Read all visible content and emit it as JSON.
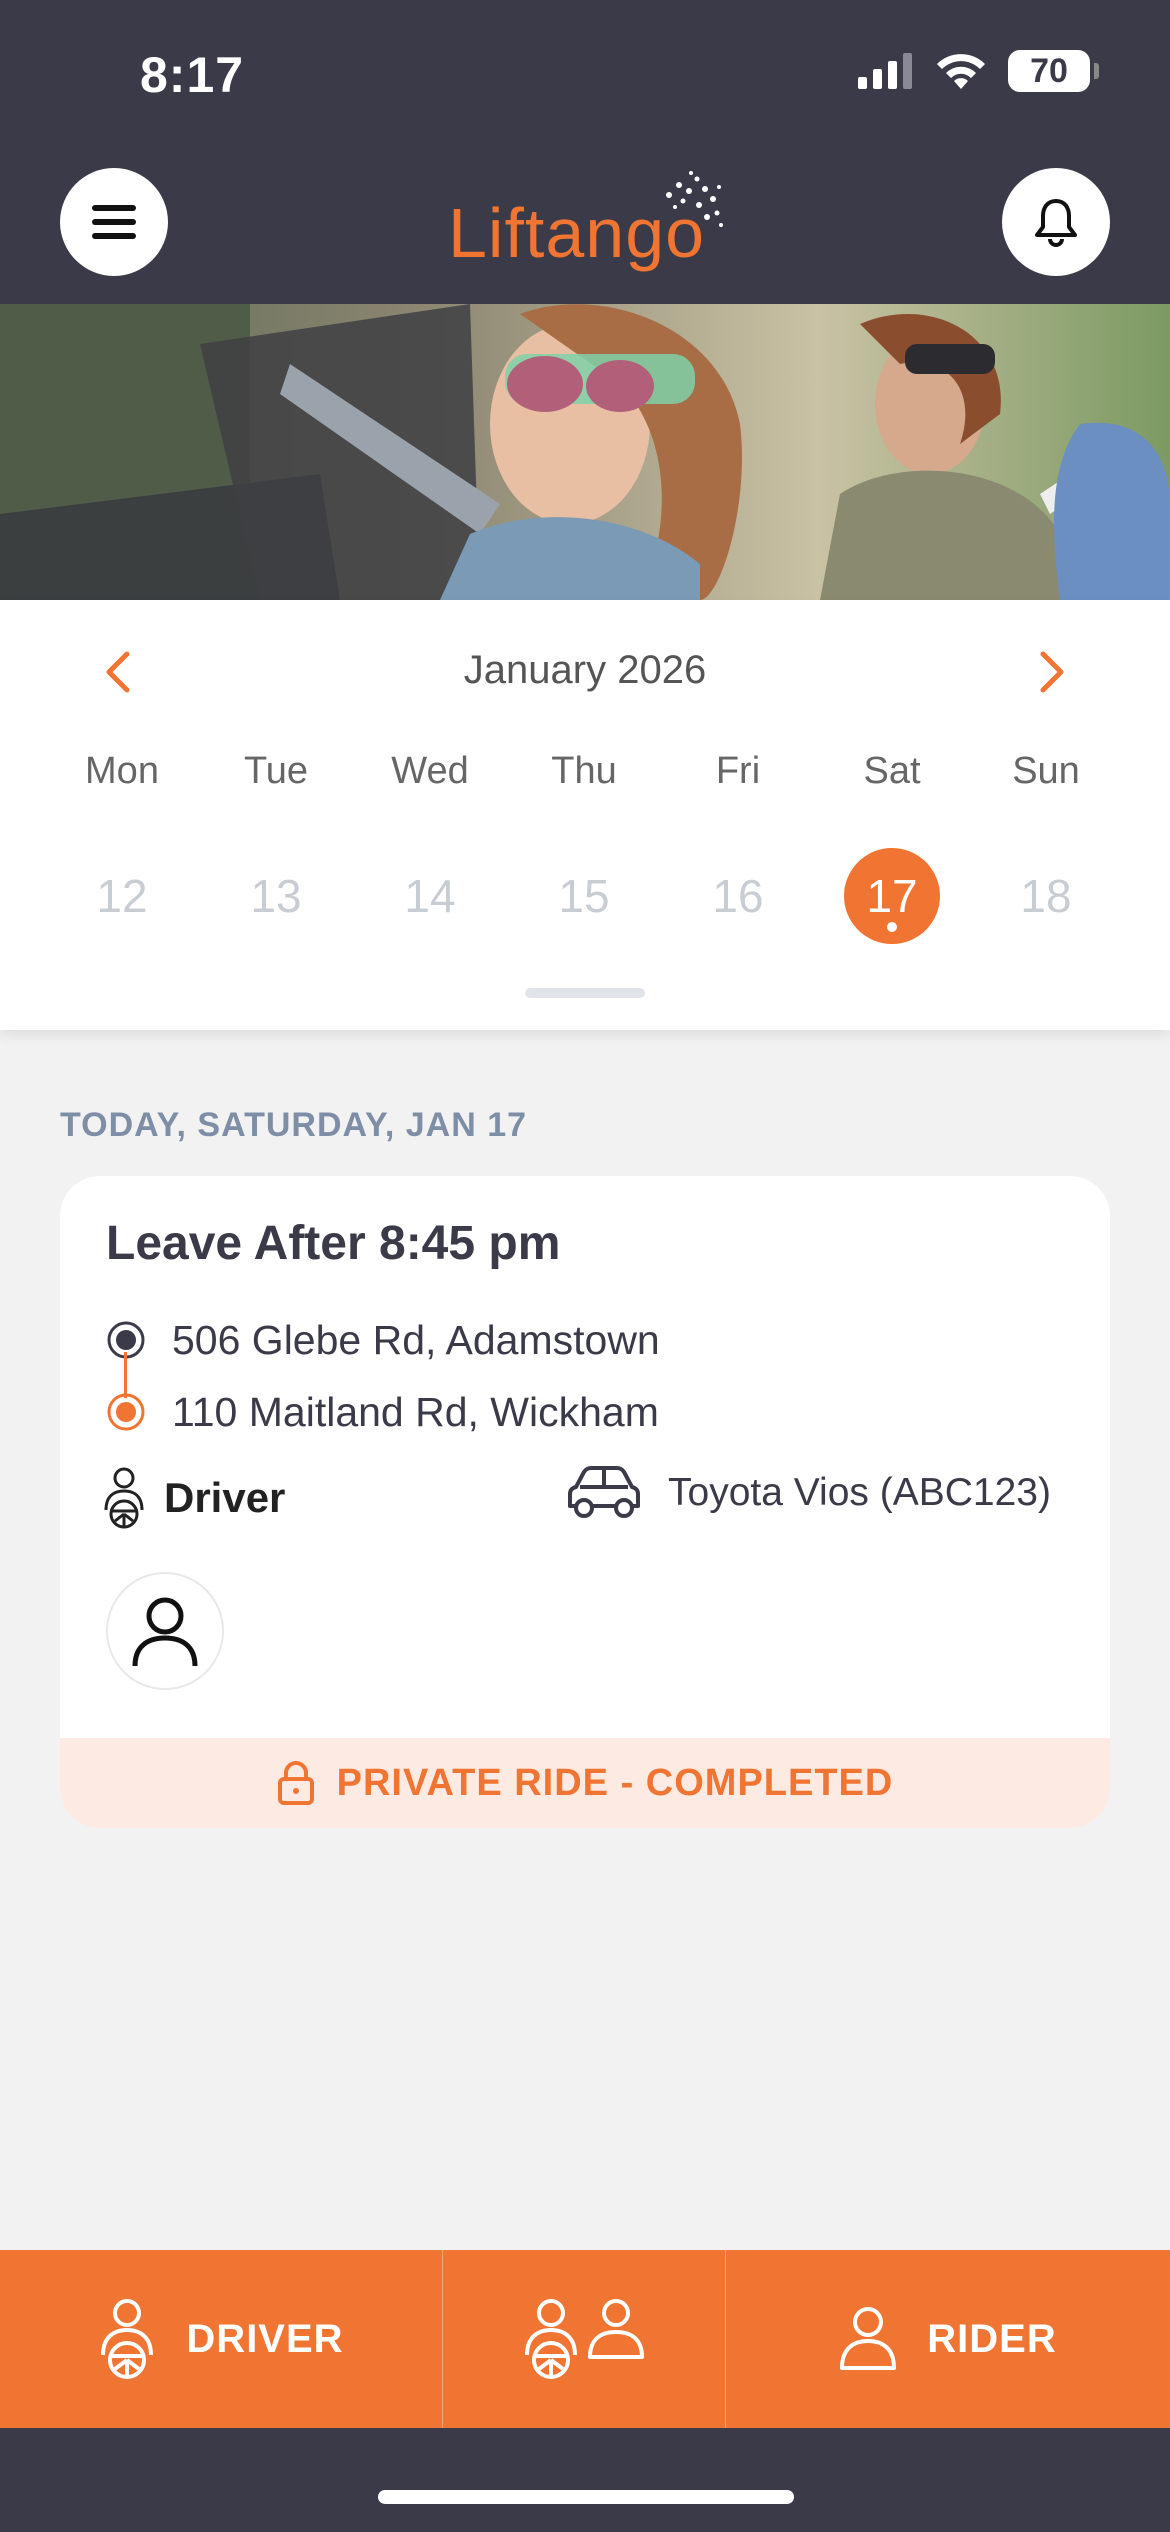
{
  "status_bar": {
    "time": "8:17",
    "battery": "70",
    "icons": [
      "signal-icon",
      "wifi-icon",
      "battery-icon"
    ]
  },
  "header": {
    "logo_text": "Liftango",
    "menu_icon": "hamburger-menu-icon",
    "notification_icon": "bell-icon"
  },
  "calendar": {
    "month_label": "January 2026",
    "weekdays": [
      "Mon",
      "Tue",
      "Wed",
      "Thu",
      "Fri",
      "Sat",
      "Sun"
    ],
    "dates": [
      "12",
      "13",
      "14",
      "15",
      "16",
      "17",
      "18"
    ],
    "selected_date": "17"
  },
  "section": {
    "label": "TODAY, SATURDAY, JAN 17"
  },
  "trip": {
    "title": "Leave After 8:45 pm",
    "origin": "506 Glebe Rd, Adamstown",
    "destination": "110 Maitland Rd, Wickham",
    "role": "Driver",
    "vehicle": "Toyota Vios (ABC123)",
    "status": "PRIVATE RIDE - COMPLETED"
  },
  "bottom_nav": {
    "driver_label": "DRIVER",
    "rider_label": "RIDER"
  },
  "colors": {
    "accent": "#f07432",
    "header_bg": "#3a3a48",
    "page_bg": "#f2f2f2",
    "status_bg": "#fdeae2",
    "section_label": "#7d8ea6"
  }
}
